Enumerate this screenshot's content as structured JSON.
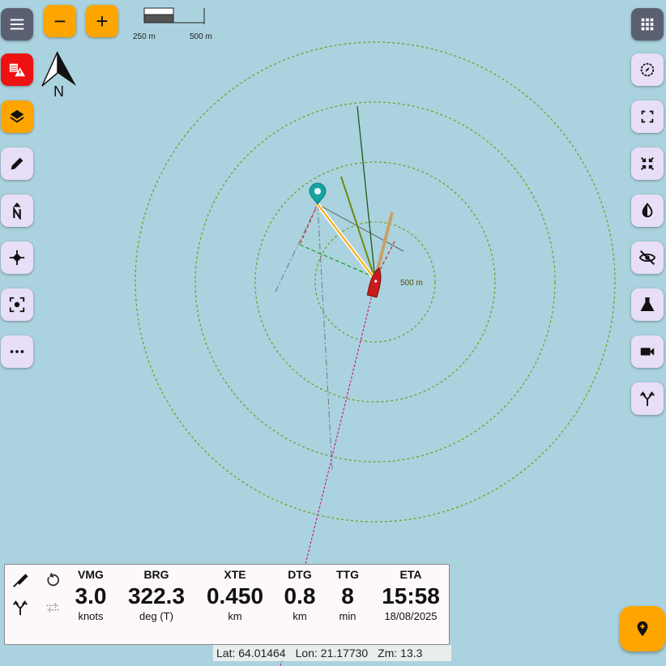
{
  "map": {
    "scale_labels": [
      "250 m",
      "500 m"
    ],
    "north_label": "N",
    "ring_label": "500 m"
  },
  "toolbar": {
    "menu_icon": "hamburger-icon",
    "zoom_out_label": "−",
    "zoom_in_label": "+",
    "apps_icon": "grid-icon"
  },
  "left_buttons": [
    {
      "name": "warnings-button",
      "icon": "chart-warning-icon",
      "color": "#ee1111"
    },
    {
      "name": "layers-button",
      "icon": "layers-icon",
      "color": "#ffa500"
    },
    {
      "name": "edit-button",
      "icon": "pencil-icon"
    },
    {
      "name": "north-up-button",
      "icon": "north-arrow-icon"
    },
    {
      "name": "route-button",
      "icon": "route-icon"
    },
    {
      "name": "center-button",
      "icon": "center-focus-icon"
    },
    {
      "name": "more-button",
      "icon": "more-horizontal-icon"
    }
  ],
  "right_buttons": [
    {
      "name": "compass-button",
      "icon": "compass-icon"
    },
    {
      "name": "fullscreen-button",
      "icon": "fullscreen-icon"
    },
    {
      "name": "collapse-button",
      "icon": "collapse-icon"
    },
    {
      "name": "contrast-button",
      "icon": "contrast-icon"
    },
    {
      "name": "hide-button",
      "icon": "eye-off-icon"
    },
    {
      "name": "lab-button",
      "icon": "flask-icon"
    },
    {
      "name": "video-button",
      "icon": "videocam-icon"
    },
    {
      "name": "fork-button",
      "icon": "fork-icon"
    }
  ],
  "nav_panel": {
    "items": [
      {
        "label": "VMG",
        "value": "3.0",
        "unit": "knots"
      },
      {
        "label": "BRG",
        "value": "322.3",
        "unit": "deg (T)"
      },
      {
        "label": "XTE",
        "value": "0.450",
        "unit": "km"
      },
      {
        "label": "DTG",
        "value": "0.8",
        "unit": "km"
      },
      {
        "label": "TTG",
        "value": "8",
        "unit": "min"
      },
      {
        "label": "ETA",
        "value": "15:58",
        "unit": "18/08/2025"
      }
    ]
  },
  "status": {
    "lat": "Lat: 64.01464",
    "lon": "Lon: 21.17730",
    "zoom": "Zm: 13.3"
  },
  "colors": {
    "water": "#aad3df",
    "accent": "#ffa500",
    "button_bg": "#e8def8",
    "alert": "#ee1111",
    "vessel": "#cc1a1a",
    "waypoint": "#17a3a3"
  }
}
